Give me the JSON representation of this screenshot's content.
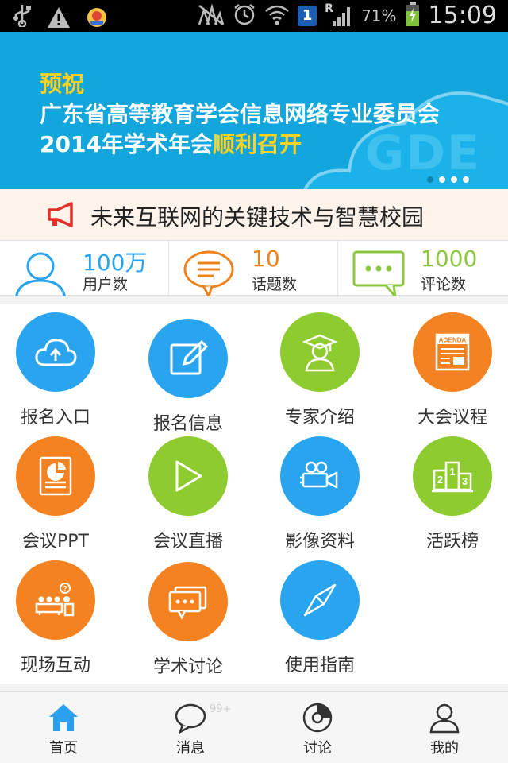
{
  "status_bar": {
    "battery_percent": "71%",
    "time": "15:09",
    "sim_badge": "1",
    "roaming": "R",
    "icons": [
      "usb-icon",
      "warning-icon",
      "app-notification-icon",
      "no-signal-icon",
      "alarm-icon",
      "wifi-icon",
      "sim-icon",
      "cell-signal-icon",
      "battery-icon"
    ]
  },
  "banner": {
    "line1": "预祝",
    "line2": "广东省高等教育学会信息网络专业委员会",
    "line3_prefix": "2014年学术年会",
    "line3_highlight": "顺利召开",
    "watermark": "GDE",
    "slide_count": 4,
    "active_slide": 1
  },
  "notice": {
    "text": "未来互联网的关键技术与智慧校园",
    "icon": "megaphone-icon"
  },
  "stats": [
    {
      "value": "100万",
      "label": "用户数",
      "color": "#28a4ee",
      "icon": "user-icon"
    },
    {
      "value": "10",
      "label": "话题数",
      "color": "#f0821e",
      "icon": "topic-bubble-icon"
    },
    {
      "value": "1000",
      "label": "评论数",
      "color": "#8dc63f",
      "icon": "comment-bubble-icon"
    }
  ],
  "grid": [
    {
      "label": "报名入口",
      "color": "#29a5f0",
      "icon": "cloud-upload-icon"
    },
    {
      "label": "报名信息",
      "color": "#29a5f0",
      "icon": "edit-icon"
    },
    {
      "label": "专家介绍",
      "color": "#8dcb2e",
      "icon": "graduate-icon"
    },
    {
      "label": "大会议程",
      "color": "#f58220",
      "icon": "agenda-icon"
    },
    {
      "label": "会议PPT",
      "color": "#f58220",
      "icon": "ppt-icon"
    },
    {
      "label": "会议直播",
      "color": "#8dcb2e",
      "icon": "play-icon"
    },
    {
      "label": "影像资料",
      "color": "#29a5f0",
      "icon": "video-camera-icon"
    },
    {
      "label": "活跃榜",
      "color": "#8dcb2e",
      "icon": "podium-icon"
    },
    {
      "label": "现场互动",
      "color": "#f58220",
      "icon": "interaction-icon"
    },
    {
      "label": "学术讨论",
      "color": "#f58220",
      "icon": "discussion-icon"
    },
    {
      "label": "使用指南",
      "color": "#29a5f0",
      "icon": "compass-icon"
    }
  ],
  "tabbar": {
    "tabs": [
      {
        "label": "首页",
        "icon": "home-icon",
        "active": true
      },
      {
        "label": "消息",
        "icon": "message-icon",
        "badge": "99+"
      },
      {
        "label": "讨论",
        "icon": "discussion-tab-icon"
      },
      {
        "label": "我的",
        "icon": "profile-icon"
      }
    ]
  },
  "colors": {
    "banner_bg": "#12a6dc",
    "highlight_yellow": "#ffd21f",
    "notice_bg": "#fdf3ea",
    "accent_blue": "#29a5f0",
    "accent_orange": "#f58220",
    "accent_green": "#8dcb2e"
  }
}
